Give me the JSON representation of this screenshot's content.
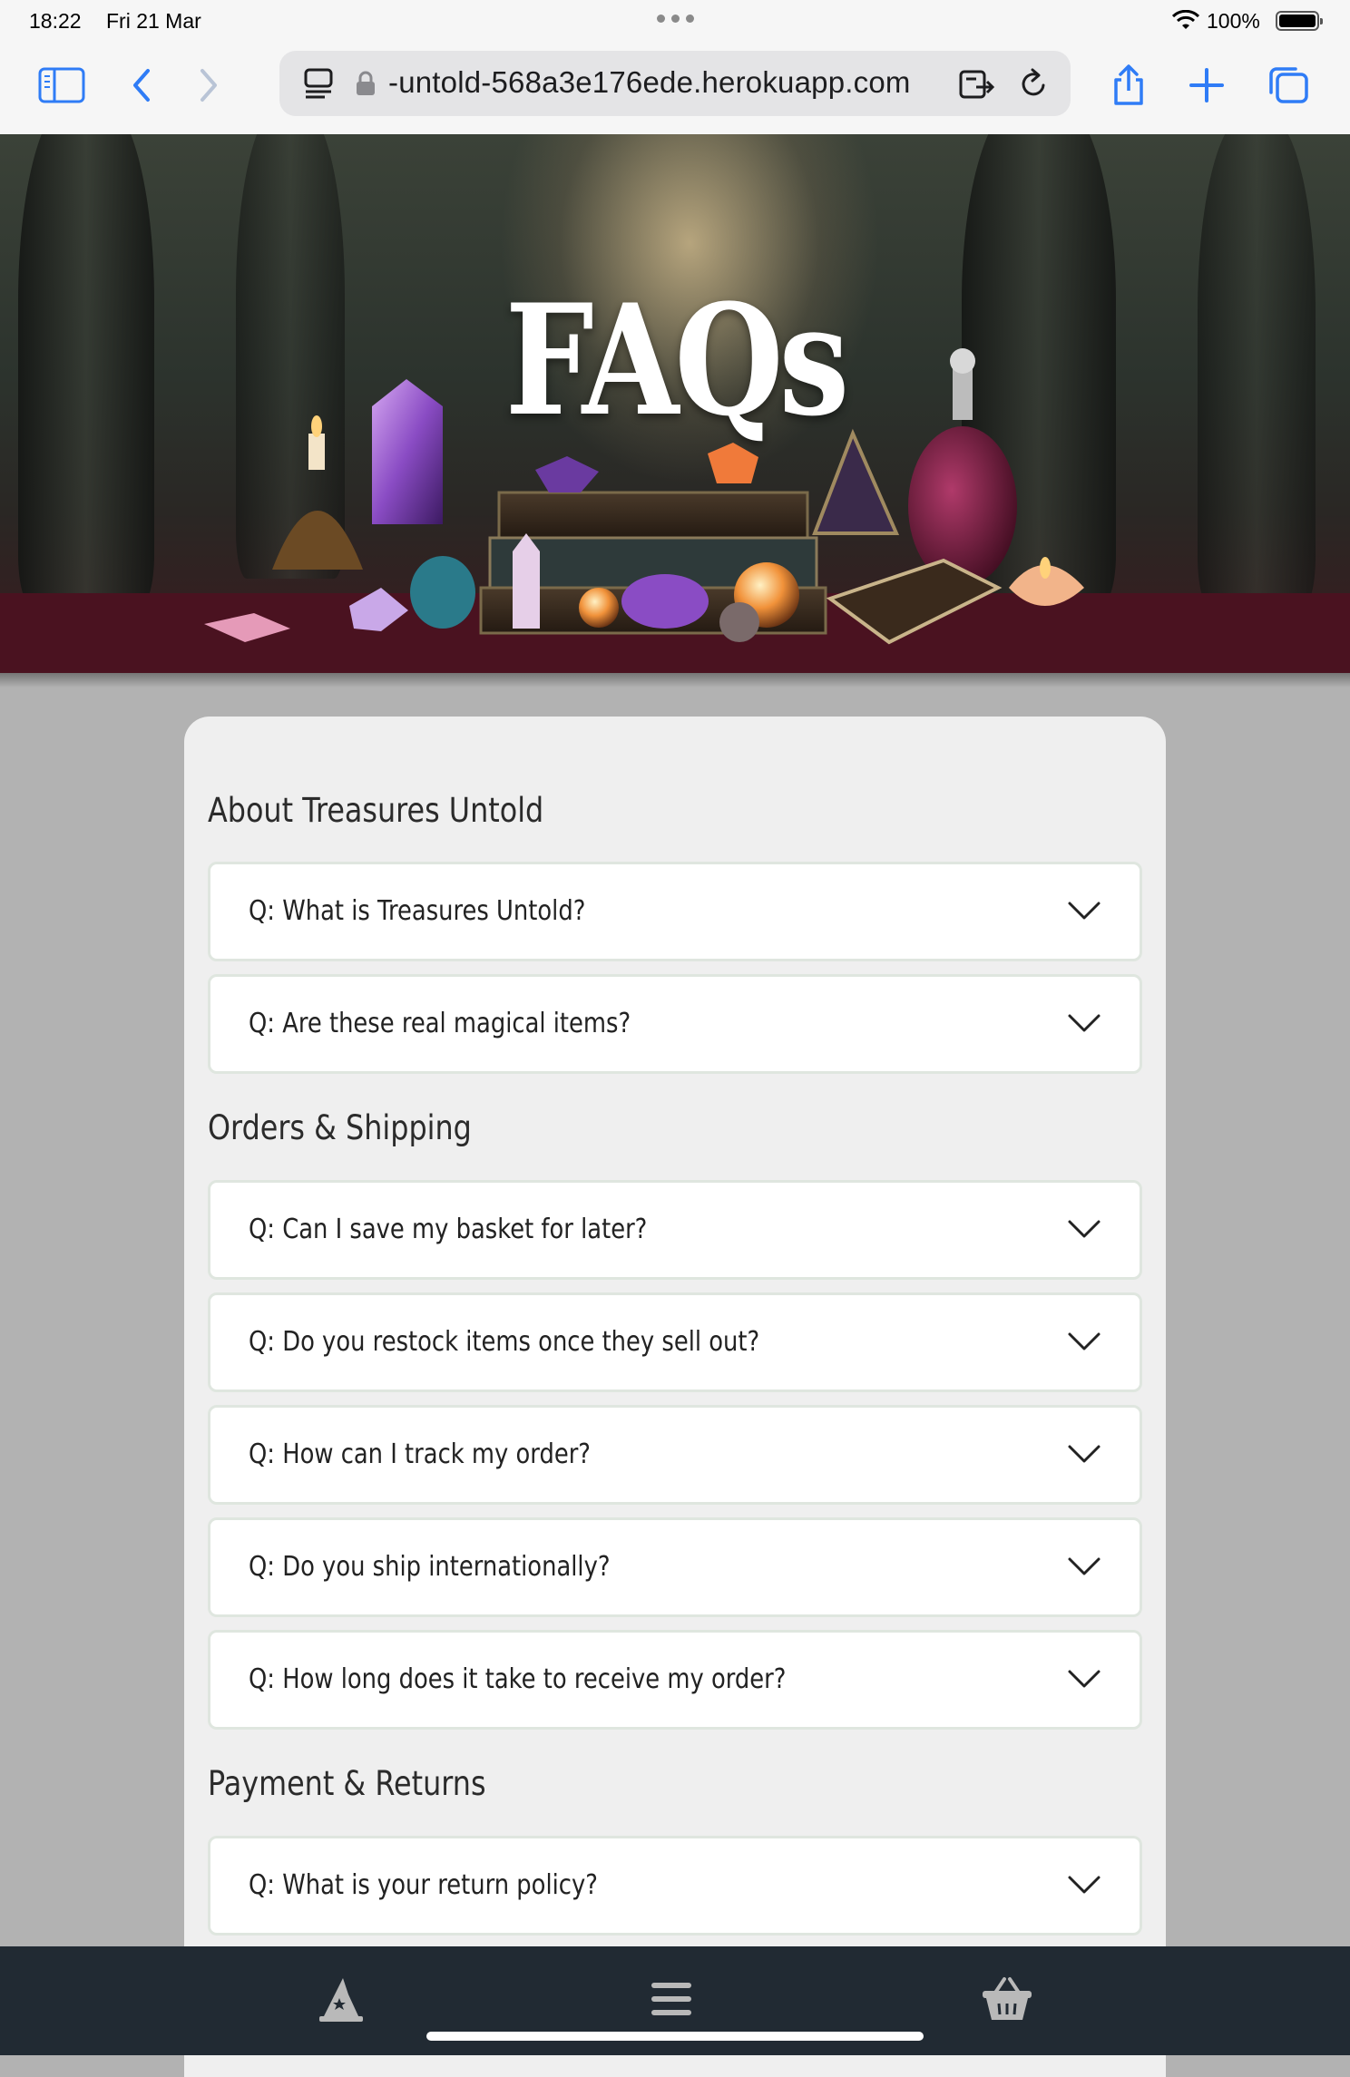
{
  "status_bar": {
    "time": "18:22",
    "date": "Fri 21 Mar",
    "battery": "100%"
  },
  "browser": {
    "url": "-untold-568a3e176ede.herokuapp.com",
    "icons": [
      "sidebar-icon",
      "back-icon",
      "forward-icon",
      "reader-icon",
      "lock-icon",
      "tab-share-icon",
      "reload-icon",
      "share-icon",
      "new-tab-icon",
      "tabs-icon"
    ]
  },
  "hero": {
    "title": "FAQs"
  },
  "sections": [
    {
      "title": "About Treasures Untold",
      "questions": [
        "Q: What is Treasures Untold?",
        "Q: Are these real magical items?"
      ]
    },
    {
      "title": "Orders & Shipping",
      "questions": [
        "Q: Can I save my basket for later?",
        "Q: Do you restock items once they sell out?",
        "Q: How can I track my order?",
        "Q: Do you ship internationally?",
        "Q: How long does it take to receive my order?"
      ]
    },
    {
      "title": "Payment & Returns",
      "questions": [
        "Q: What is your return policy?"
      ]
    }
  ],
  "bottom_nav": {
    "icons": [
      "wizard-hat-icon",
      "menu-icon",
      "basket-icon"
    ]
  },
  "colors": {
    "page_background": "#b2b2b2",
    "card_background": "#efefef",
    "bottom_nav": "#212a33",
    "browser_accent": "#2f7cf6"
  }
}
